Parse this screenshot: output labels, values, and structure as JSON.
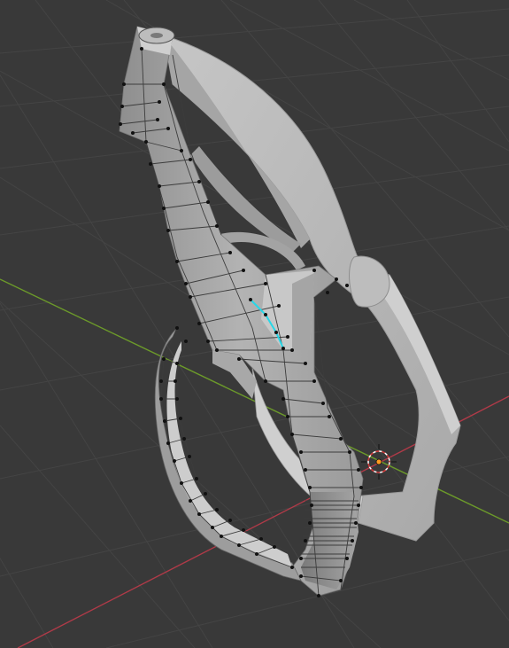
{
  "viewport": {
    "mode": "edit-mode",
    "shading": "solid",
    "background_color": "#393939",
    "grid_color": "#444444",
    "x_axis_color": "#b03a48",
    "y_axis_color": "#6c9a2a",
    "mesh_color": "#b8b8b8",
    "vertex_color": "#111111",
    "selected_edge_color": "#27d8e8",
    "cursor_icon": "3d-cursor-icon",
    "origin_icon": "object-origin-icon"
  }
}
